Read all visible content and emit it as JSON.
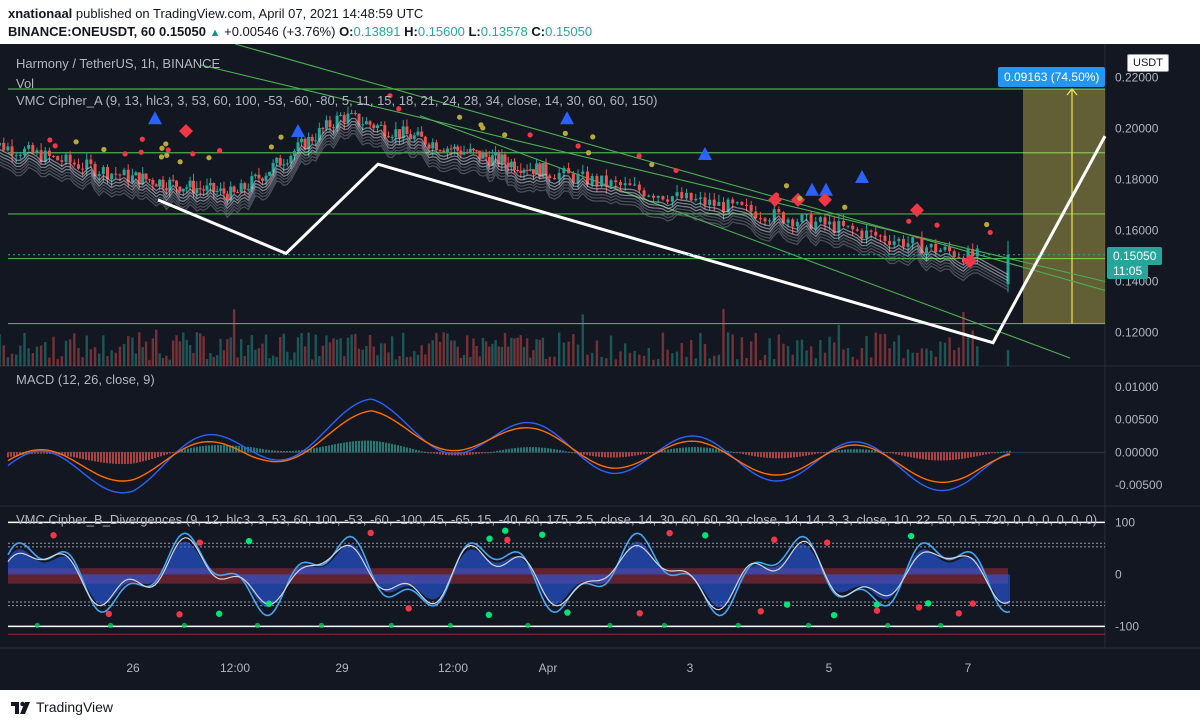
{
  "header": {
    "author": "xnationaal",
    "published_text": "published on TradingView.com, April 07, 2021 14:48:59 UTC",
    "symbol": "BINANCE:ONEUSDT, 60",
    "last": "0.15050",
    "change": "+0.00546 (+3.76%)",
    "o_label": "O:",
    "o": "0.13891",
    "h_label": "H:",
    "h": "0.15600",
    "l_label": "L:",
    "l": "0.13578",
    "c_label": "C:",
    "c": "0.15050"
  },
  "panes": {
    "main": {
      "title": "Harmony / TetherUS, 1h, BINANCE",
      "vol_label": "Vol",
      "indicator_label": "VMC Cipher_A (9, 13, hlc3, 3, 53, 60, 100, -53, -60, -80, 5, 11, 15, 18, 21, 24, 28, 34, close, 14, 30, 60, 60, 150)",
      "currency": "USDT",
      "measure_badge": "0.09163 (74.50%)",
      "price_badge": "0.15050",
      "countdown_badge": "11:05",
      "y_ticks": [
        "0.22000",
        "0.20000",
        "0.18000",
        "0.16000",
        "0.14000",
        "0.12000"
      ]
    },
    "macd": {
      "title": "MACD (12, 26, close, 9)",
      "y_ticks": [
        "0.01000",
        "0.00500",
        "0.00000",
        "-0.00500"
      ]
    },
    "cipher_b": {
      "title": "VMC Cipher_B_Divergences (9, 12, hlc3, 3, 53, 60, 100, -53, -60, -100, 45, -65, 15, -40, 60, 175, 2.5, close, 14, 30, 60, 60, 30, close, 14, 14, 3, 3, close, 10, 22, 50, 0.5, 720, 0, 0, 0, 0, 0, 0)",
      "y_ticks": [
        "100",
        "0",
        "-100"
      ]
    }
  },
  "x_axis": {
    "labels": [
      "26",
      "12:00",
      "29",
      "12:00",
      "Apr",
      "3",
      "5",
      "7"
    ]
  },
  "footer": {
    "brand": "TradingView"
  },
  "colors": {
    "background": "#131722",
    "green_lines": "#4caf50",
    "up": "#26a69a",
    "down": "#ef5350",
    "macd": "#2962ff",
    "signal": "#ff6d00",
    "badge_blue": "#2196f3",
    "measure_fill": "#f5e35a"
  },
  "chart_data": [
    {
      "type": "line",
      "title": "Harmony / TetherUS, 1h, BINANCE",
      "x": [
        "26",
        "12:00",
        "29",
        "12:00",
        "Apr",
        "3",
        "5",
        "7"
      ],
      "series": [
        {
          "name": "Harmony / TetherUS",
          "values": [
            0.181,
            0.174,
            0.205,
            0.192,
            0.183,
            0.172,
            0.162,
            0.15
          ]
        }
      ],
      "ylim": [
        0.11,
        0.23
      ],
      "horizontal_levels": [
        0.2155,
        0.1905,
        0.1665,
        0.149,
        0.1235
      ],
      "measure": {
        "from": 0.1235,
        "to": 0.2155,
        "label": "0.09163 (74.50%)"
      },
      "last_price": 0.1505
    },
    {
      "type": "line",
      "title": "MACD (12, 26, close, 9)",
      "x": [
        "26",
        "12:00",
        "29",
        "12:00",
        "Apr",
        "3",
        "5",
        "7"
      ],
      "series": [
        {
          "name": "MACD",
          "values": [
            -0.003,
            0.001,
            0.005,
            0.002,
            0.0,
            -0.001,
            -0.0015,
            -0.003
          ]
        },
        {
          "name": "Signal",
          "values": [
            -0.002,
            0.0,
            0.004,
            0.002,
            0.0,
            -0.001,
            -0.0012,
            -0.0025
          ]
        }
      ],
      "ylim": [
        -0.007,
        0.012
      ]
    },
    {
      "type": "area",
      "title": "VMC Cipher_B_Divergences",
      "x": [
        "26",
        "12:00",
        "29",
        "12:00",
        "Apr",
        "3",
        "5",
        "7"
      ],
      "series": [
        {
          "values": [
            40,
            -40,
            60,
            -50,
            30,
            -60,
            45,
            90
          ]
        }
      ],
      "ylim": [
        -130,
        120
      ],
      "levels": [
        100,
        60,
        53,
        -53,
        -60,
        -100
      ]
    }
  ]
}
